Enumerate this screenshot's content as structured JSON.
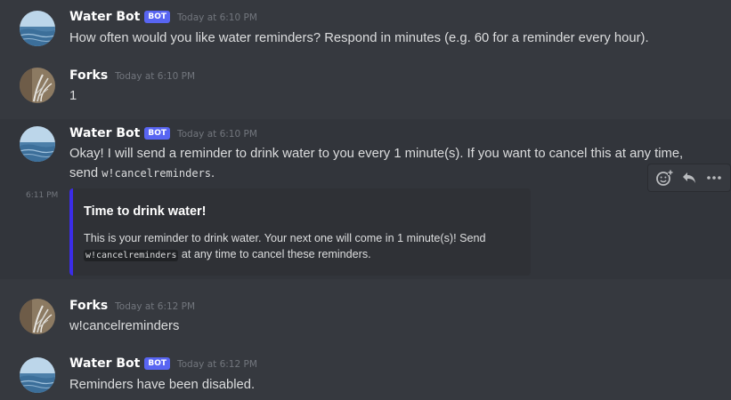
{
  "colors": {
    "background": "#36393f",
    "hover_background": "#32353b",
    "username": "#ffffff",
    "timestamp": "#72767d",
    "text": "#dcddde",
    "bot_tag": "#5865f2",
    "embed_background": "#2f3136",
    "embed_accent": "#3b2ce8"
  },
  "messages": [
    {
      "author": "Water Bot",
      "bot_tag": "BOT",
      "timestamp": "Today at 6:10 PM",
      "text": "How often would you like water reminders? Respond in minutes (e.g. 60 for a reminder every hour)."
    },
    {
      "author": "Forks",
      "timestamp": "Today at 6:10 PM",
      "text": "1"
    },
    {
      "author": "Water Bot",
      "bot_tag": "BOT",
      "timestamp": "Today at 6:10 PM",
      "text_line1": "Okay! I will send a reminder to drink water to you every 1 minute(s). If you want to cancel this at any time,",
      "text_line2_prefix": "send ",
      "text_line2_code": "w!cancelreminders",
      "text_line2_suffix": "."
    },
    {
      "author": "Forks",
      "timestamp": "Today at 6:12 PM",
      "text": "w!cancelreminders"
    },
    {
      "author": "Water Bot",
      "bot_tag": "BOT",
      "timestamp": "Today at 6:12 PM",
      "text": "Reminders have been disabled."
    }
  ],
  "embed_message": {
    "side_timestamp": "6:11 PM",
    "title": "Time to drink water!",
    "description_line1": "This is your reminder to drink water. Your next one will come in 1 minute(s)! Send",
    "description_code": "w!cancelreminders",
    "description_line2_suffix": " at any time to cancel these reminders."
  },
  "toolbar": {
    "icons": [
      "add-reaction-icon",
      "reply-icon",
      "more-options-icon"
    ]
  }
}
